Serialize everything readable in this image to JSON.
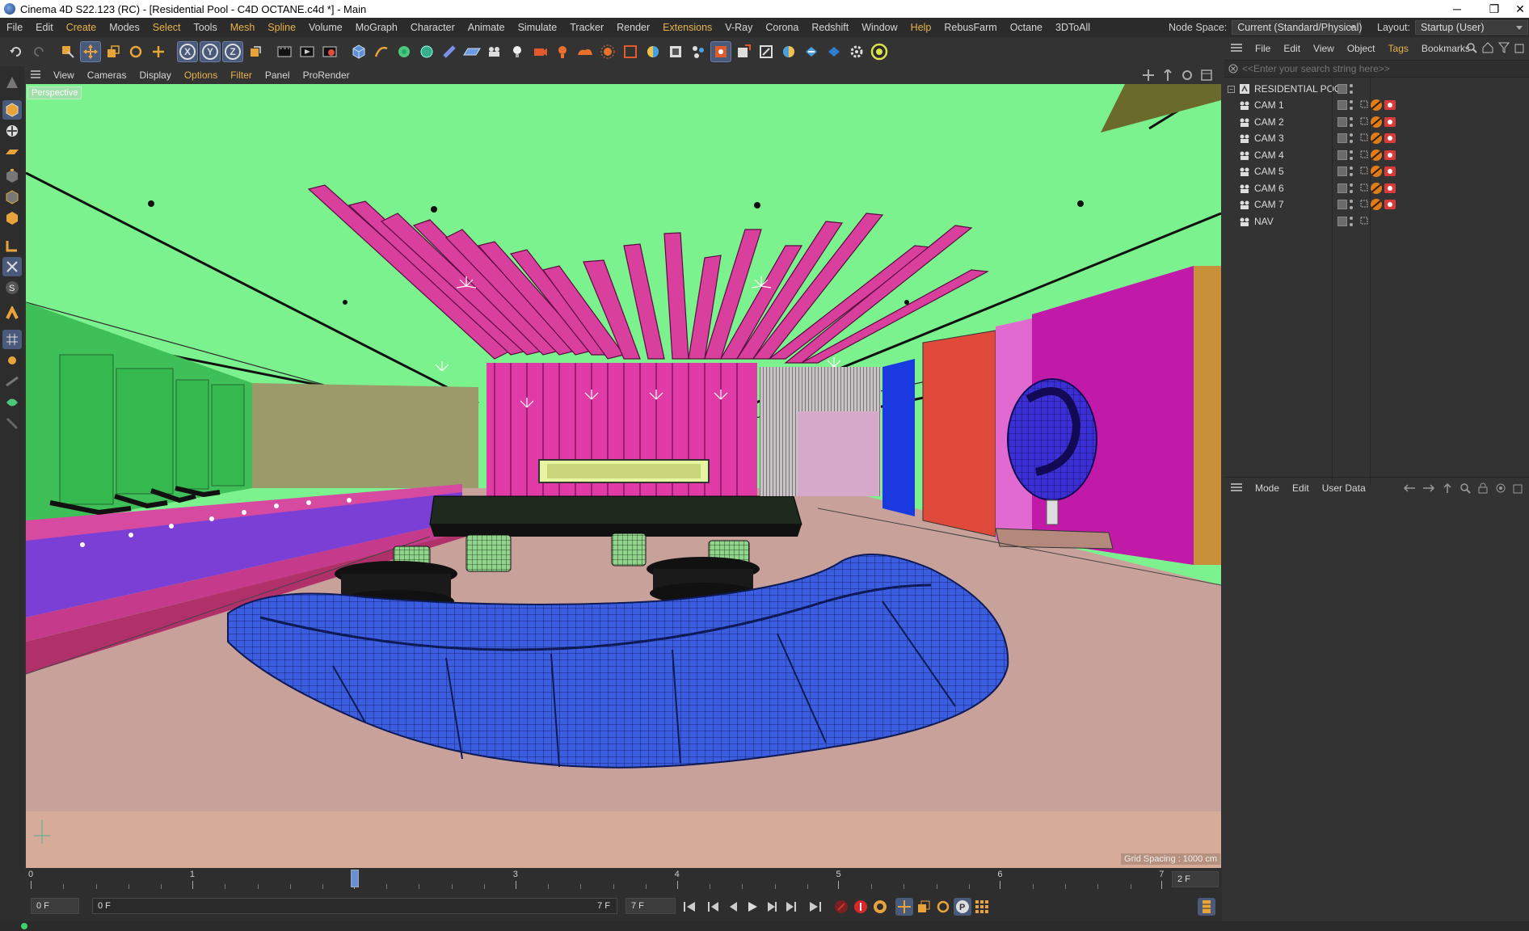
{
  "window": {
    "title": "Cinema 4D S22.123 (RC) - [Residential Pool - C4D OCTANE.c4d *] - Main",
    "minimize": "─",
    "restore": "❐",
    "close": "✕"
  },
  "menubar": {
    "items": [
      "File",
      "Edit",
      "Create",
      "Modes",
      "Select",
      "Tools",
      "Mesh",
      "Spline",
      "Volume",
      "MoGraph",
      "Character",
      "Animate",
      "Simulate",
      "Tracker",
      "Render",
      "Extensions",
      "V-Ray",
      "Corona",
      "Redshift",
      "Window",
      "Help",
      "RebusFarm",
      "Octane",
      "3DToAll"
    ],
    "highlighted": [
      "Create",
      "Select",
      "Mesh",
      "Spline",
      "Extensions",
      "Help"
    ],
    "node_space_label": "Node Space:",
    "node_space_value": "Current (Standard/Physical)",
    "layout_label": "Layout:",
    "layout_value": "Startup (User)"
  },
  "toolbar": {
    "axis_x": "X",
    "axis_y": "Y",
    "axis_z": "Z"
  },
  "viewport": {
    "menu": [
      "View",
      "Cameras",
      "Display",
      "Options",
      "Filter",
      "Panel",
      "ProRender"
    ],
    "highlighted": [
      "Options",
      "Filter"
    ],
    "label": "Perspective",
    "grid_spacing": "Grid Spacing : 1000 cm"
  },
  "object_manager": {
    "menu": [
      "File",
      "Edit",
      "View",
      "Object",
      "Tags",
      "Bookmarks"
    ],
    "highlighted": [
      "Tags"
    ],
    "search_placeholder": "<<Enter your search string here>>",
    "root": "RESIDENTIAL POOL",
    "objects": [
      "CAM 1",
      "CAM 2",
      "CAM 3",
      "CAM 4",
      "CAM 5",
      "CAM 6",
      "CAM 7",
      "NAV"
    ]
  },
  "attribute_manager": {
    "menu": [
      "Mode",
      "Edit",
      "User Data"
    ]
  },
  "timeline": {
    "ticks": [
      "0",
      "1",
      "2",
      "3",
      "4",
      "5",
      "6",
      "7"
    ],
    "current_frame": 2,
    "end_field": "2 F"
  },
  "playback": {
    "start_field": "0 F",
    "range_start": "0 F",
    "range_end": "7 F",
    "end_field": "7 F"
  },
  "colors": {
    "accent": "#e8b348",
    "ceiling": "#7cf28f",
    "floor": "#c9a19b",
    "sofa": "#3b5de0",
    "feature_wall": "#e03aa6"
  }
}
